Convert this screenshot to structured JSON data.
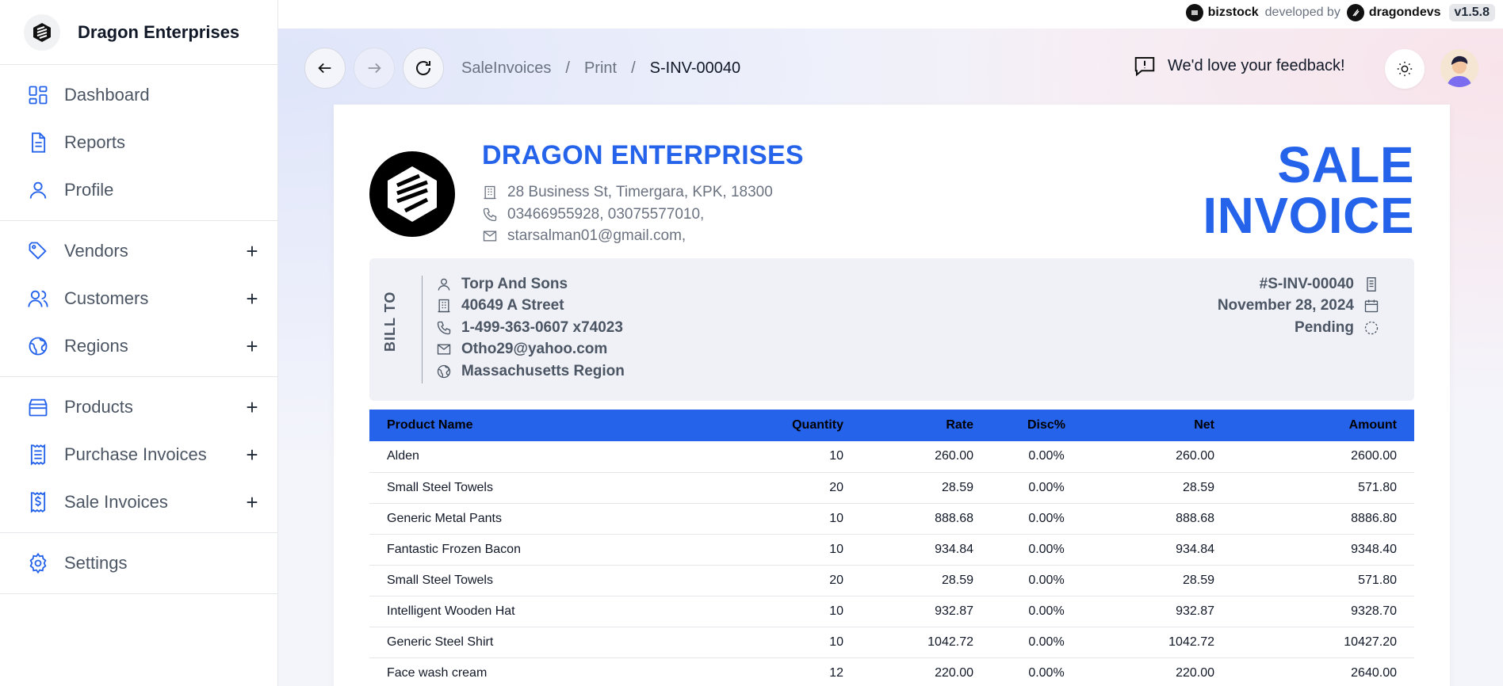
{
  "app": {
    "company": "Dragon Enterprises",
    "powered_by": {
      "product": "bizstock",
      "developed_by_label": "developed by",
      "developer": "dragondevs",
      "version": "v1.5.8"
    }
  },
  "sidebar": {
    "groups": [
      [
        {
          "label": "Dashboard",
          "icon": "dashboard-icon"
        },
        {
          "label": "Reports",
          "icon": "document-icon"
        },
        {
          "label": "Profile",
          "icon": "user-icon"
        }
      ],
      [
        {
          "label": "Vendors",
          "icon": "tag-icon",
          "expandable": true
        },
        {
          "label": "Customers",
          "icon": "users-icon",
          "expandable": true
        },
        {
          "label": "Regions",
          "icon": "globe-icon",
          "expandable": true
        }
      ],
      [
        {
          "label": "Products",
          "icon": "box-icon",
          "expandable": true
        },
        {
          "label": "Purchase Invoices",
          "icon": "receipt-icon",
          "expandable": true
        },
        {
          "label": "Sale Invoices",
          "icon": "dollar-receipt-icon",
          "expandable": true
        }
      ],
      [
        {
          "label": "Settings",
          "icon": "gear-icon"
        }
      ]
    ],
    "plus_symbol": "+"
  },
  "header": {
    "breadcrumbs": [
      "SaleInvoices",
      "Print",
      "S-INV-00040"
    ],
    "separator": "/",
    "feedback_label": "We'd love your feedback!"
  },
  "invoice": {
    "company_name": "DRAGON ENTERPRISES",
    "address": "28 Business St, Timergara, KPK, 18300",
    "phones": "03466955928, 03075577010,",
    "email": "starsalman01@gmail.com,",
    "title_line1": "SALE",
    "title_line2": "INVOICE",
    "bill_to_label": "BILL TO",
    "customer": {
      "name": "Torp And Sons",
      "address": "40649 A Street",
      "phone": "1-499-363-0607 x74023",
      "email": "Otho29@yahoo.com",
      "region": "Massachusetts Region"
    },
    "number": "#S-INV-00040",
    "date": "November 28, 2024",
    "status": "Pending",
    "columns": [
      "Product Name",
      "Quantity",
      "Rate",
      "Disc%",
      "Net",
      "Amount"
    ],
    "rows": [
      [
        "Alden",
        "10",
        "260.00",
        "0.00%",
        "260.00",
        "2600.00"
      ],
      [
        "Small Steel Towels",
        "20",
        "28.59",
        "0.00%",
        "28.59",
        "571.80"
      ],
      [
        "Generic Metal Pants",
        "10",
        "888.68",
        "0.00%",
        "888.68",
        "8886.80"
      ],
      [
        "Fantastic Frozen Bacon",
        "10",
        "934.84",
        "0.00%",
        "934.84",
        "9348.40"
      ],
      [
        "Small Steel Towels",
        "20",
        "28.59",
        "0.00%",
        "28.59",
        "571.80"
      ],
      [
        "Intelligent Wooden Hat",
        "10",
        "932.87",
        "0.00%",
        "932.87",
        "9328.70"
      ],
      [
        "Generic Steel Shirt",
        "10",
        "1042.72",
        "0.00%",
        "1042.72",
        "10427.20"
      ],
      [
        "Face wash cream",
        "12",
        "220.00",
        "0.00%",
        "220.00",
        "2640.00"
      ]
    ]
  },
  "colors": {
    "accent": "#2563eb",
    "nav_icon": "#2563eb",
    "text_muted": "#6b7280"
  }
}
